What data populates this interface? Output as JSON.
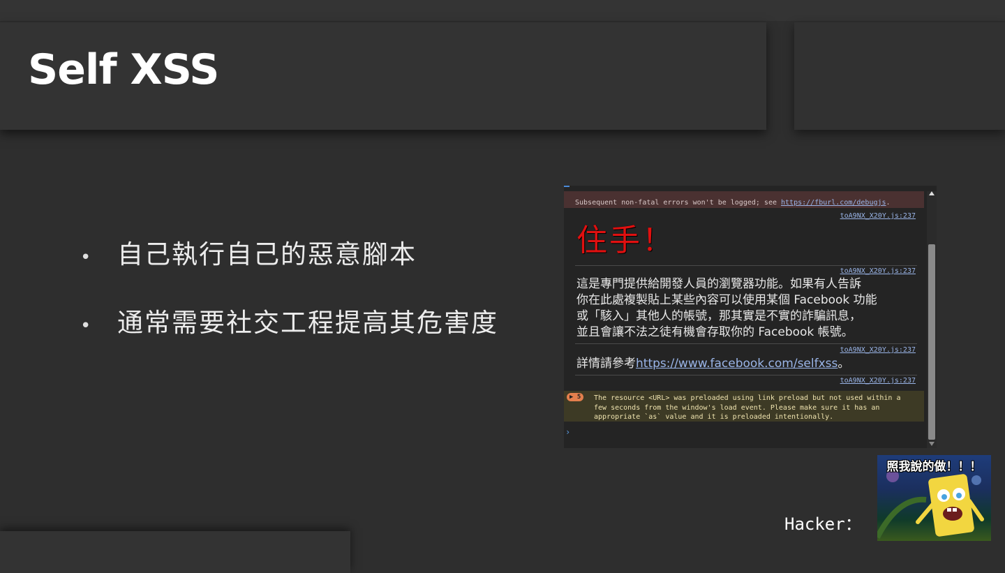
{
  "slide": {
    "title": "Self XSS",
    "bullets": [
      {
        "bullet": "•",
        "text": "自己執行自己的惡意腳本"
      },
      {
        "bullet": "•",
        "text": "通常需要社交工程提高其危害度"
      }
    ]
  },
  "console": {
    "error_text": "Subsequent non-fatal errors won't be logged; see ",
    "error_link": "https://fburl.com/debugjs",
    "error_end": ".",
    "source_link": "toA9NX_X20Y.js:237",
    "stop_text": "住手！",
    "warning_line1": "這是專門提供給開發人員的瀏覽器功能。如果有人告訴",
    "warning_line2": "你在此處複製貼上某些內容可以使用某個 Facebook 功能",
    "warning_line3": "或「駭入」其他人的帳號，那其實是不實的詐騙訊息，",
    "warning_line4": "並且會讓不法之徒有機會存取你的 Facebook 帳號。",
    "details_prefix": "詳情請參考",
    "details_link": "https://www.facebook.com/selfxss",
    "details_end": "。",
    "badge": "▶ 5",
    "preload_warning": "The resource <URL> was preloaded using link preload but not used within a few seconds from the window's load event. Please make sure it has an appropriate `as` value and it is preloaded intentionally.",
    "prompt": "›"
  },
  "hacker": {
    "label": "Hacker：",
    "meme_caption": "照我說的做！！！"
  }
}
